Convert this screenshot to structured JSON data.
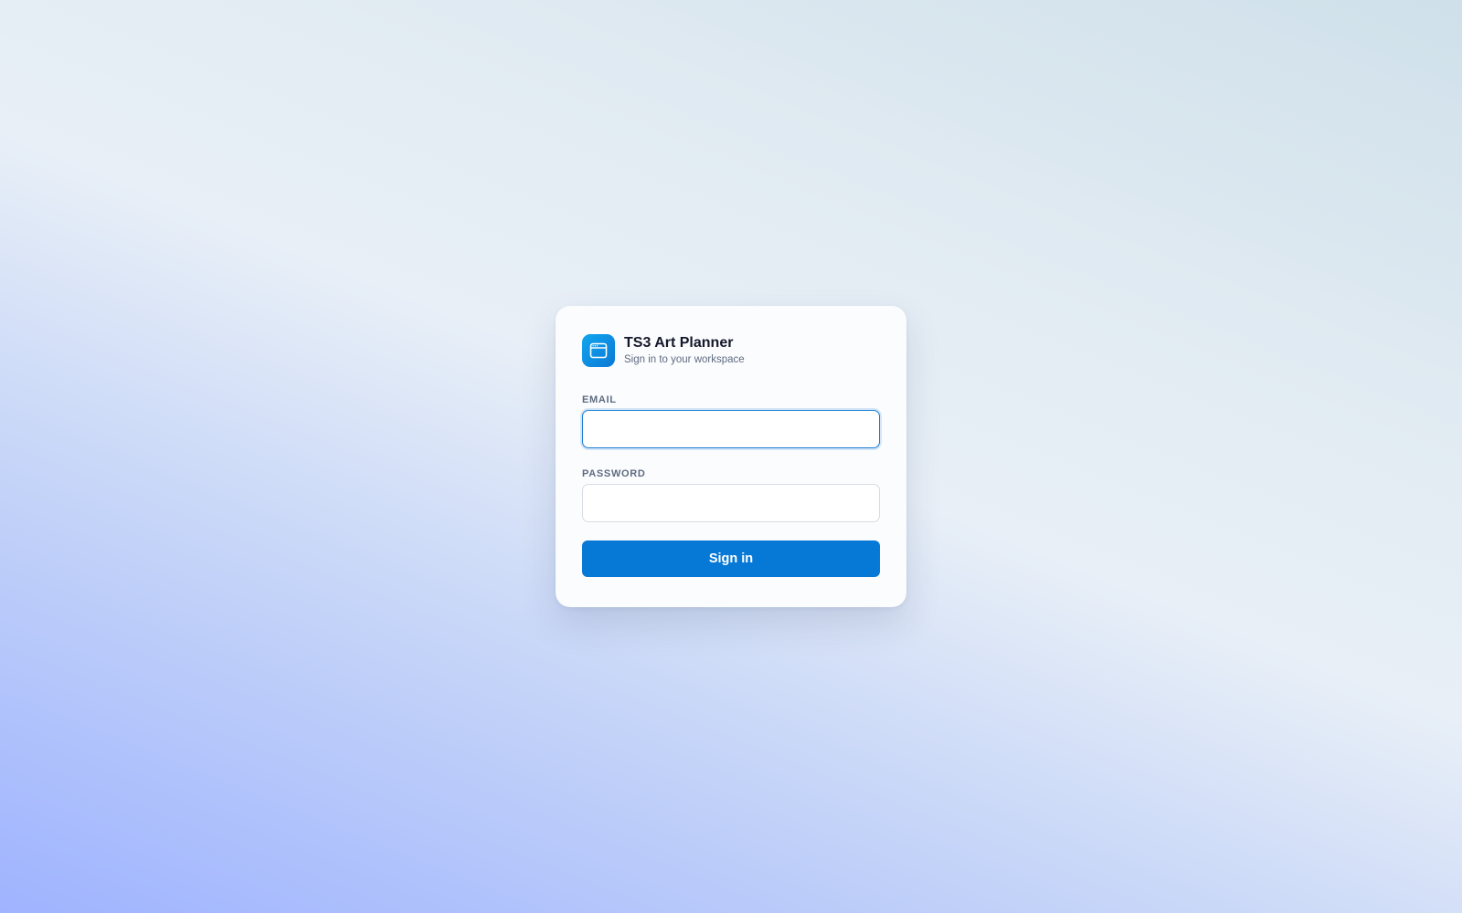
{
  "app": {
    "title": "TS3 Art Planner",
    "subtitle": "Sign in to your workspace",
    "logo_icon": "app-window-icon"
  },
  "form": {
    "email": {
      "label": "EMAIL",
      "value": "",
      "placeholder": "",
      "focused": true
    },
    "password": {
      "label": "PASSWORD",
      "value": "",
      "placeholder": ""
    },
    "submit_label": "Sign in"
  },
  "colors": {
    "accent": "#0678d6",
    "logo_gradient_start": "#11a6ee",
    "logo_gradient_end": "#0a78d6",
    "title_text": "#14182a",
    "muted_text": "#5f6b80",
    "focus_ring": "#1f7fd4"
  }
}
